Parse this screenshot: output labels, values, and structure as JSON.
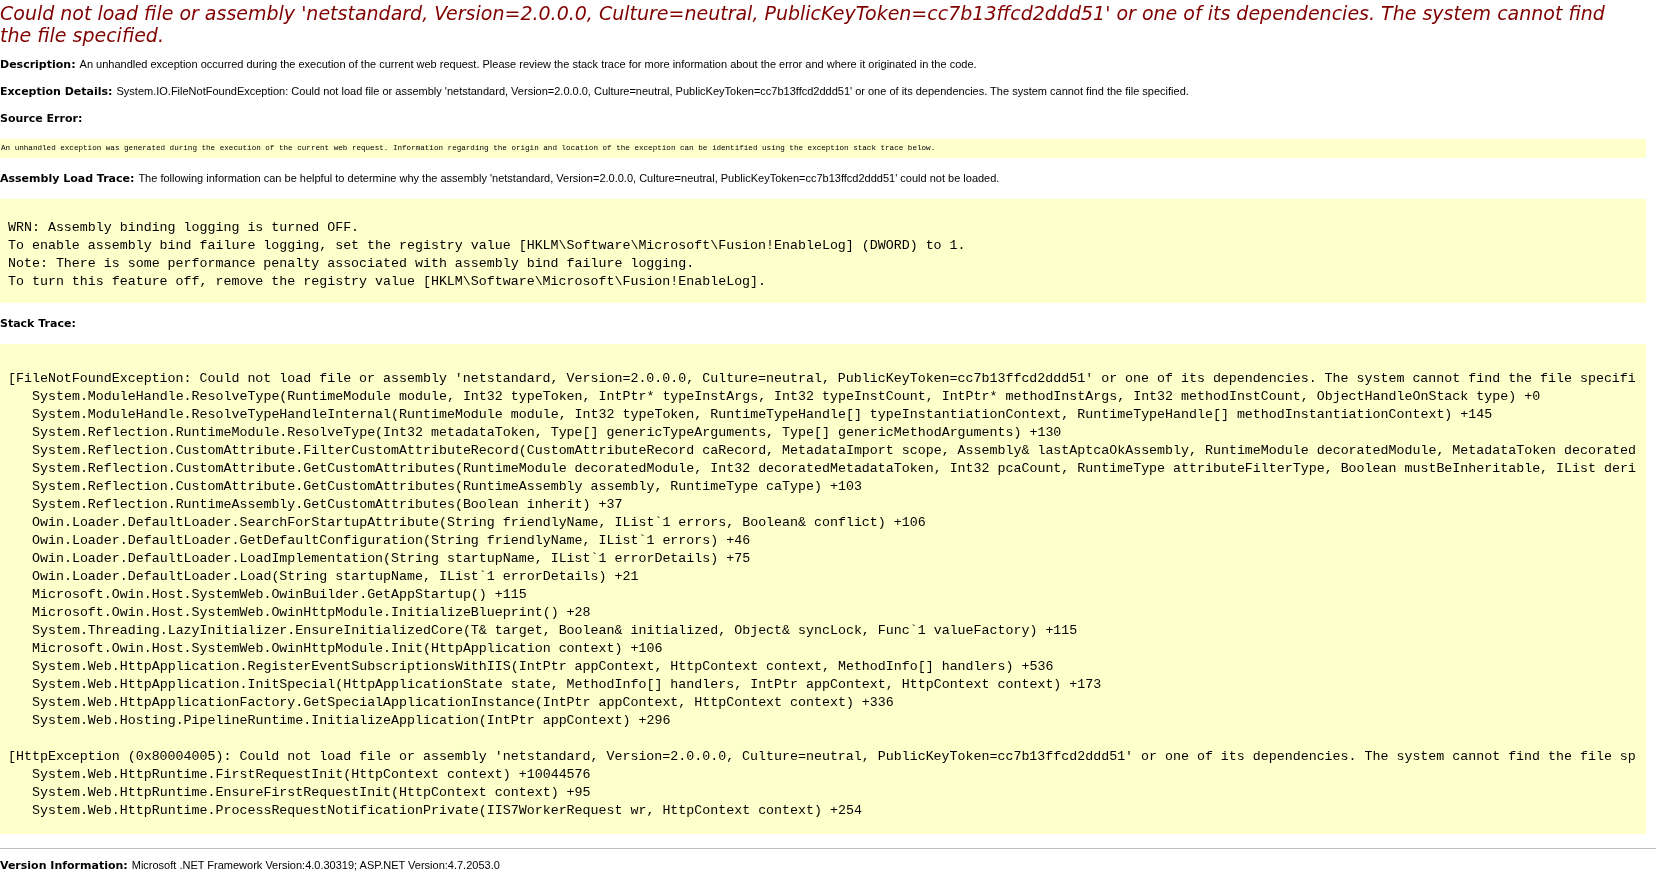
{
  "title": "Could not load file or assembly 'netstandard, Version=2.0.0.0, Culture=neutral, PublicKeyToken=cc7b13ffcd2ddd51' or one of its dependencies. The system cannot find the file specified.",
  "blocks": [
    {
      "kind": "field",
      "label": "Description:",
      "text": "An unhandled exception occurred during the execution of the current web request. Please review the stack trace for more information about the error and where it originated in the code."
    },
    {
      "kind": "field",
      "label": "Exception Details:",
      "text": "System.IO.FileNotFoundException: Could not load file or assembly 'netstandard, Version=2.0.0.0, Culture=neutral, PublicKeyToken=cc7b13ffcd2ddd51' or one of its dependencies. The system cannot find the file specified."
    },
    {
      "kind": "heading",
      "label": "Source Error:"
    },
    {
      "kind": "note",
      "lines": [
        "An unhandled exception was generated during the execution of the current web request. Information regarding the origin and location of the exception can be identified using the exception stack trace below."
      ]
    },
    {
      "kind": "field",
      "label": "Assembly Load Trace:",
      "text": "The following information can be helpful to determine why the assembly 'netstandard, Version=2.0.0.0, Culture=neutral, PublicKeyToken=cc7b13ffcd2ddd51' could not be loaded."
    },
    {
      "kind": "code",
      "lines": [
        "WRN: Assembly binding logging is turned OFF.",
        "To enable assembly bind failure logging, set the registry value [HKLM\\Software\\Microsoft\\Fusion!EnableLog] (DWORD) to 1.",
        "Note: There is some performance penalty associated with assembly bind failure logging.",
        "To turn this feature off, remove the registry value [HKLM\\Software\\Microsoft\\Fusion!EnableLog]."
      ]
    },
    {
      "kind": "heading",
      "label": "Stack Trace:"
    },
    {
      "kind": "stack",
      "groups": [
        {
          "header": "[FileNotFoundException: Could not load file or assembly 'netstandard, Version=2.0.0.0, Culture=neutral, PublicKeyToken=cc7b13ffcd2ddd51' or one of its dependencies. The system cannot find the file specifi",
          "frames": [
            "System.ModuleHandle.ResolveType(RuntimeModule module, Int32 typeToken, IntPtr* typeInstArgs, Int32 typeInstCount, IntPtr* methodInstArgs, Int32 methodInstCount, ObjectHandleOnStack type) +0",
            "System.ModuleHandle.ResolveTypeHandleInternal(RuntimeModule module, Int32 typeToken, RuntimeTypeHandle[] typeInstantiationContext, RuntimeTypeHandle[] methodInstantiationContext) +145",
            "System.Reflection.RuntimeModule.ResolveType(Int32 metadataToken, Type[] genericTypeArguments, Type[] genericMethodArguments) +130",
            "System.Reflection.CustomAttribute.FilterCustomAttributeRecord(CustomAttributeRecord caRecord, MetadataImport scope, Assembly& lastAptcaOkAssembly, RuntimeModule decoratedModule, MetadataToken decorated",
            "System.Reflection.CustomAttribute.GetCustomAttributes(RuntimeModule decoratedModule, Int32 decoratedMetadataToken, Int32 pcaCount, RuntimeType attributeFilterType, Boolean mustBeInheritable, IList deri",
            "System.Reflection.CustomAttribute.GetCustomAttributes(RuntimeAssembly assembly, RuntimeType caType) +103",
            "System.Reflection.RuntimeAssembly.GetCustomAttributes(Boolean inherit) +37",
            "Owin.Loader.DefaultLoader.SearchForStartupAttribute(String friendlyName, IList`1 errors, Boolean& conflict) +106",
            "Owin.Loader.DefaultLoader.GetDefaultConfiguration(String friendlyName, IList`1 errors) +46",
            "Owin.Loader.DefaultLoader.LoadImplementation(String startupName, IList`1 errorDetails) +75",
            "Owin.Loader.DefaultLoader.Load(String startupName, IList`1 errorDetails) +21",
            "Microsoft.Owin.Host.SystemWeb.OwinBuilder.GetAppStartup() +115",
            "Microsoft.Owin.Host.SystemWeb.OwinHttpModule.InitializeBlueprint() +28",
            "System.Threading.LazyInitializer.EnsureInitializedCore(T& target, Boolean& initialized, Object& syncLock, Func`1 valueFactory) +115",
            "Microsoft.Owin.Host.SystemWeb.OwinHttpModule.Init(HttpApplication context) +106",
            "System.Web.HttpApplication.RegisterEventSubscriptionsWithIIS(IntPtr appContext, HttpContext context, MethodInfo[] handlers) +536",
            "System.Web.HttpApplication.InitSpecial(HttpApplicationState state, MethodInfo[] handlers, IntPtr appContext, HttpContext context) +173",
            "System.Web.HttpApplicationFactory.GetSpecialApplicationInstance(IntPtr appContext, HttpContext context) +336",
            "System.Web.Hosting.PipelineRuntime.InitializeApplication(IntPtr appContext) +296"
          ]
        },
        {
          "header": "[HttpException (0x80004005): Could not load file or assembly 'netstandard, Version=2.0.0.0, Culture=neutral, PublicKeyToken=cc7b13ffcd2ddd51' or one of its dependencies. The system cannot find the file sp",
          "frames": [
            "System.Web.HttpRuntime.FirstRequestInit(HttpContext context) +10044576",
            "System.Web.HttpRuntime.EnsureFirstRequestInit(HttpContext context) +95",
            "System.Web.HttpRuntime.ProcessRequestNotificationPrivate(IIS7WorkerRequest wr, HttpContext context) +254"
          ]
        }
      ]
    },
    {
      "kind": "rule"
    },
    {
      "kind": "field",
      "label": "Version Information:",
      "text": "Microsoft .NET Framework Version:4.0.30319; ASP.NET Version:4.7.2053.0"
    }
  ]
}
